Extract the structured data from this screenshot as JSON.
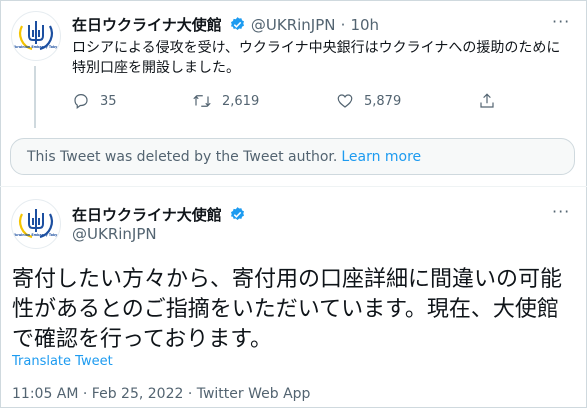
{
  "tweet1": {
    "display_name": "在日ウクライナ大使館",
    "handle": "@UKRinJPN",
    "separator": "·",
    "time_ago": "10h",
    "text": "ロシアによる侵攻を受け、ウクライナ中央銀行はウクライナへの援助のために特別口座を開設しました。",
    "reply_count": "35",
    "retweet_count": "2,619",
    "like_count": "5,879"
  },
  "deleted_notice": {
    "text": "This Tweet was deleted by the Tweet author.",
    "link": "Learn more"
  },
  "tweet2": {
    "display_name": "在日ウクライナ大使館",
    "handle": "@UKRinJPN",
    "text": "寄付したい方々から、寄付用の口座詳細に間違いの可能性があるとのご指摘をいただいています。現在、大使館で確認を行っております。",
    "translate": "Translate Tweet",
    "meta": "11:05 AM · Feb 25, 2022 · Twitter Web App"
  },
  "avatar_text": "Ukrainian Embassy Tokyo",
  "icons": [
    "verified-icon",
    "more-icon",
    "reply-icon",
    "retweet-icon",
    "like-icon",
    "share-icon",
    "trident-icon"
  ],
  "colors": {
    "accent": "#1d9bf0",
    "text": "#0f1419",
    "muted": "#536471",
    "border": "#cfd9de",
    "trident_blue": "#1c4fa0",
    "trident_yellow": "#f5c400"
  }
}
